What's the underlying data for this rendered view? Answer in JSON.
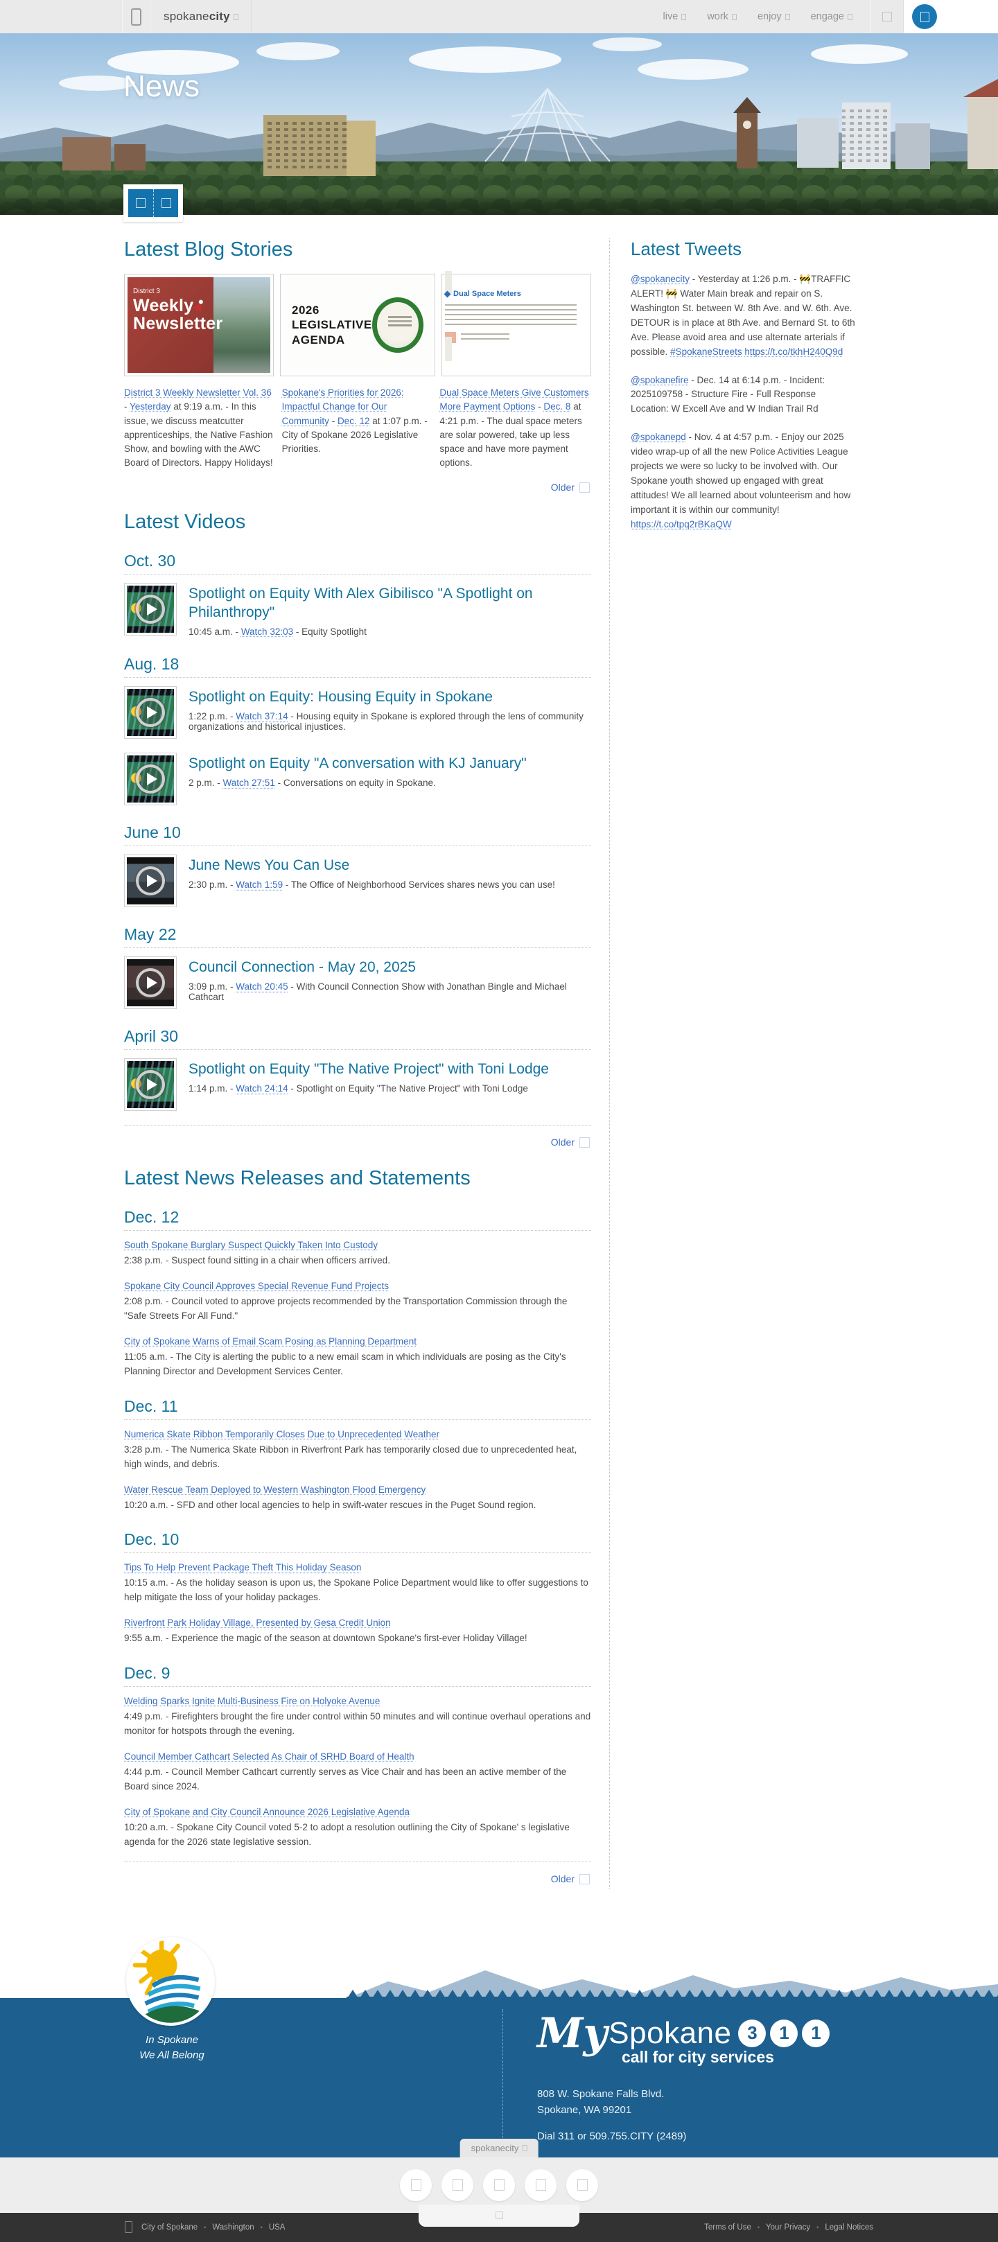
{
  "common": {
    "dash": " - ",
    "bullet": "•"
  },
  "header": {
    "logo_light": "spokane",
    "logo_bold": "city",
    "nav": [
      {
        "label": "live"
      },
      {
        "label": "work"
      },
      {
        "label": "enjoy"
      },
      {
        "label": "engage"
      }
    ]
  },
  "hero": {
    "title": "News"
  },
  "blog": {
    "heading": "Latest Blog Stories",
    "older_label": "Older",
    "stories": [
      {
        "card": {
          "label": "District 3",
          "line1": "Weekly",
          "line2": "Newsletter"
        },
        "title": "District 3 Weekly Newsletter Vol. 36",
        "date": "Yesterday",
        "body": "at 9:19 a.m. - In this issue, we discuss meatcutter apprenticeships, the Native Fashion Show, and bowling with the AWC Board of Directors. Happy Holidays!"
      },
      {
        "card": {
          "line1": "2026",
          "line2": "LEGISLATIVE",
          "line3": "AGENDA"
        },
        "title": "Spokane's Priorities for 2026: Impactful Change for Our Community",
        "date": "Dec. 12",
        "body": "at 1:07 p.m. - City of Spokane 2026 Legislative Priorities."
      },
      {
        "card_title": "Dual Space Meters",
        "title": "Dual Space Meters Give Customers More Payment Options",
        "date": "Dec. 8",
        "body": "at 4:21 p.m. - The dual space meters are solar powered, take up less space and have more payment options."
      }
    ]
  },
  "videos": {
    "heading": "Latest Videos",
    "older_label": "Older",
    "groups": [
      {
        "date": "Oct. 30",
        "items": [
          {
            "title": "Spotlight on Equity With Alex Gibilisco \"A Spotlight on Philanthropy\"",
            "time": "10:45 a.m. -",
            "watch": "Watch 32:03",
            "desc": "- Equity Spotlight"
          }
        ]
      },
      {
        "date": "Aug. 18",
        "items": [
          {
            "title": "Spotlight on Equity: Housing Equity in Spokane",
            "time": "1:22 p.m. -",
            "watch": "Watch 37:14",
            "desc": "- Housing equity in Spokane is explored through the lens of community organizations and historical injustices."
          },
          {
            "title": "Spotlight on Equity \"A conversation with KJ January\"",
            "time": "2 p.m. -",
            "watch": "Watch 27:51",
            "desc": "- Conversations on equity in Spokane."
          }
        ]
      },
      {
        "date": "June 10",
        "items": [
          {
            "title": "June News You Can Use",
            "time": "2:30 p.m. -",
            "watch": "Watch 1:59",
            "desc": "- The Office of Neighborhood Services shares news you can use!"
          }
        ]
      },
      {
        "date": "May 22",
        "items": [
          {
            "title": "Council Connection - May 20, 2025",
            "time": "3:09 p.m. -",
            "watch": "Watch 20:45",
            "desc": "- With Council Connection Show with Jonathan Bingle and Michael Cathcart"
          }
        ]
      },
      {
        "date": "April 30",
        "items": [
          {
            "title": "Spotlight on Equity \"The Native Project\" with Toni Lodge",
            "time": "1:14 p.m. -",
            "watch": "Watch 24:14",
            "desc": "- Spotlight on Equity \"The Native Project\" with Toni Lodge"
          }
        ]
      }
    ]
  },
  "news": {
    "heading": "Latest News Releases and Statements",
    "older_label": "Older",
    "groups": [
      {
        "date": "Dec. 12",
        "items": [
          {
            "title": "South Spokane Burglary Suspect Quickly Taken Into Custody",
            "desc": "2:38 p.m. - Suspect found sitting in a chair when officers arrived."
          },
          {
            "title": "Spokane City Council Approves Special Revenue Fund Projects",
            "desc": "2:08 p.m. - Council voted to approve projects recommended by the Transportation Commission through the \"Safe Streets For All Fund.\""
          },
          {
            "title": "City of Spokane Warns of Email Scam Posing as Planning Department",
            "desc": "11:05 a.m. - The City is alerting the public to a new email scam in which individuals are posing as the City's Planning Director and Development Services Center."
          }
        ]
      },
      {
        "date": "Dec. 11",
        "items": [
          {
            "title": "Numerica Skate Ribbon Temporarily Closes Due to Unprecedented Weather",
            "desc": "3:28 p.m. - The Numerica Skate Ribbon in Riverfront Park has temporarily closed due to unprecedented heat, high winds, and debris."
          },
          {
            "title": "Water Rescue Team Deployed to Western Washington Flood Emergency",
            "desc": "10:20 a.m. - SFD and other local agencies to help in swift-water rescues in the Puget Sound region."
          }
        ]
      },
      {
        "date": "Dec. 10",
        "items": [
          {
            "title": "Tips To Help Prevent Package Theft This Holiday Season",
            "desc": "10:15 a.m. - As the holiday season is upon us, the Spokane Police Department would like to offer suggestions to help mitigate the loss of your holiday packages."
          },
          {
            "title": "Riverfront Park Holiday Village, Presented by Gesa Credit Union",
            "desc": "9:55 a.m. - Experience the magic of the season at downtown Spokane's first-ever Holiday Village!"
          }
        ]
      },
      {
        "date": "Dec. 9",
        "items": [
          {
            "title": "Welding Sparks Ignite Multi-Business Fire on Holyoke Avenue",
            "desc": "4:49 p.m. - Firefighters brought the fire under control within 50 minutes and will continue overhaul operations and monitor for hotspots through the evening."
          },
          {
            "title": "Council Member Cathcart Selected As Chair of SRHD Board of Health",
            "desc": "4:44 p.m. - Council Member Cathcart currently serves as Vice Chair and has been an active member of the Board since 2024."
          },
          {
            "title": "City of Spokane and City Council Announce 2026 Legislative Agenda",
            "desc": "10:20 a.m. - Spokane City Council voted 5-2 to adopt a resolution outlining the City of Spokane' s legislative agenda for the 2026 state legislative session."
          }
        ]
      }
    ]
  },
  "tweets": {
    "heading": "Latest Tweets",
    "items": [
      {
        "handle": "@spokanecity",
        "body": "- Yesterday at 1:26 p.m. - 🚧TRAFFIC ALERT! 🚧 Water Main break and repair on S. Washington St. between W. 8th Ave. and W. 6th. Ave. DETOUR is in place at 8th Ave. and Bernard St. to 6th Ave. Please avoid area and use alternate arterials if possible.",
        "hashtag": "#SpokaneStreets",
        "url": "https://t.co/tkhH240Q9d"
      },
      {
        "handle": "@spokanefire",
        "body": "- Dec. 14 at 6:14 p.m. - Incident: 2025109758 - Structure Fire - Full Response Location: W Excell Ave and W Indian Trail Rd",
        "hashtag": "",
        "url": ""
      },
      {
        "handle": "@spokanepd",
        "body": "- Nov. 4 at 4:57 p.m. - Enjoy our 2025 video wrap-up of all the new Police Activities League projects we were so lucky to be involved with. Our Spokane youth showed up engaged with great attitudes! We all learned about volunteerism and how important it is within our community!",
        "hashtag": "",
        "url": "https://t.co/tpq2rBKaQW"
      }
    ]
  },
  "footer": {
    "tagline_line1": "In Spokane",
    "tagline_line2": "We All Belong",
    "brand_my": "My",
    "brand_spokane": "Spokane",
    "brand_digits": [
      "3",
      "1",
      "1"
    ],
    "brand_tagline": "call for city services",
    "address_line1": "808 W. Spokane Falls Blvd.",
    "address_line2": "Spokane, WA 99201",
    "dial": "Dial 311 or 509.755.CITY (2489)",
    "tab_label": "spokanecity",
    "bottom_left": [
      "City of Spokane",
      "Washington",
      "USA"
    ],
    "bottom_right": [
      "Terms of Use",
      "Your Privacy",
      "Legal Notices"
    ]
  },
  "colors": {
    "accent_teal": "#13749e",
    "link_blue": "#3a6dbf",
    "header_blue": "#1878b4",
    "footer_blue": "#1d5f8e"
  }
}
